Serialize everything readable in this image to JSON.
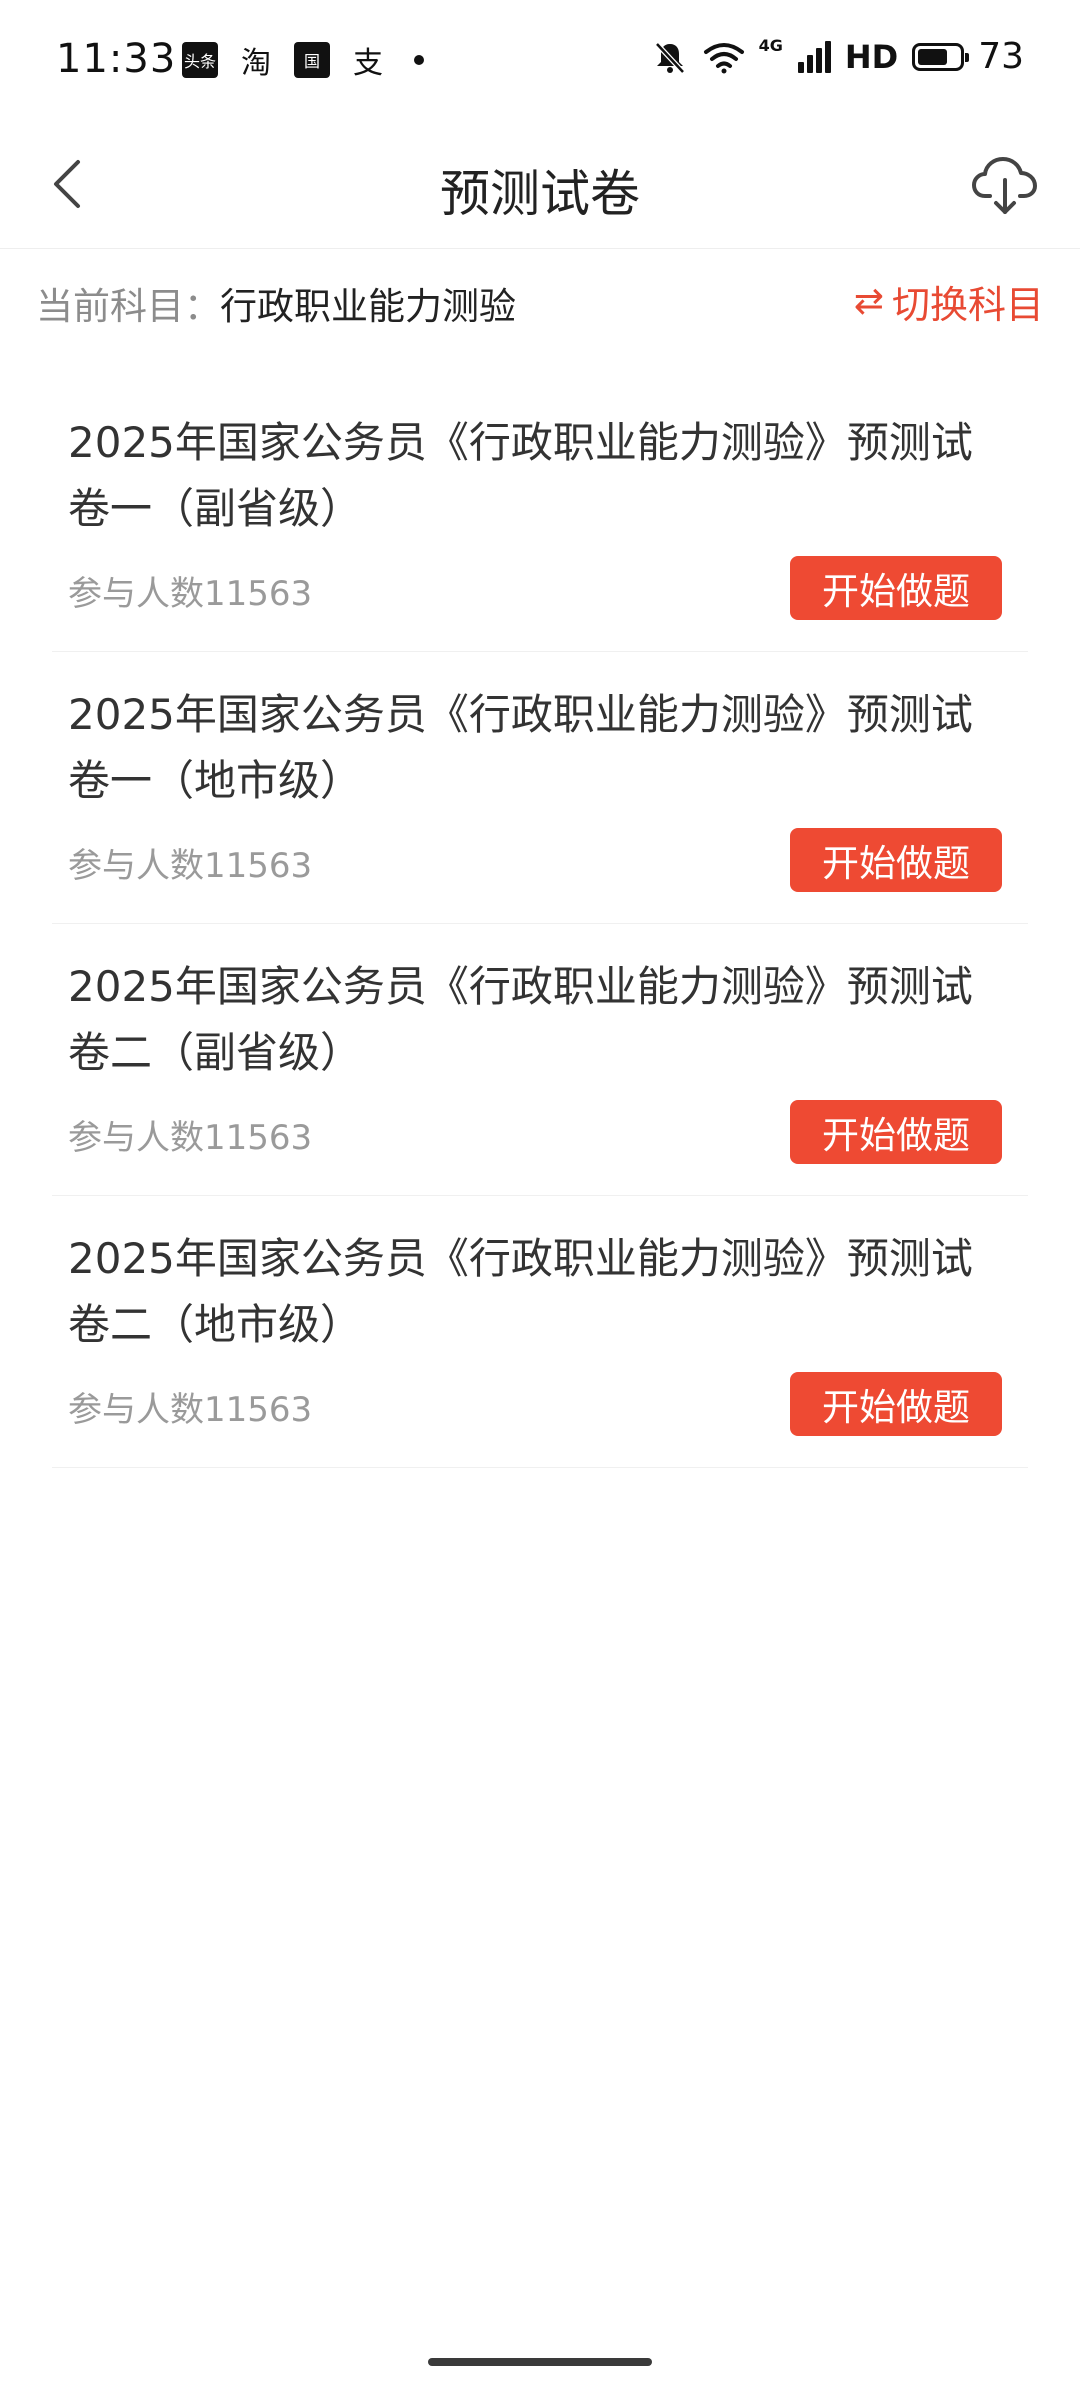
{
  "status_bar": {
    "time": "11:33",
    "apps": [
      "头条",
      "淘",
      "国",
      "支"
    ],
    "network": "4G",
    "hd": "HD",
    "battery_level": "73",
    "battery_fraction": 0.73
  },
  "nav": {
    "title": "预测试卷",
    "back_icon": "chevron-left-icon",
    "download_icon": "cloud-download-icon"
  },
  "subject": {
    "label": "当前科目：",
    "value": "行政职业能力测验",
    "switch_icon": "⇄",
    "switch_label": "切换科目",
    "accent_color": "#e84a33"
  },
  "papers": [
    {
      "title": "2025年国家公务员《行政职业能力测验》预测试卷一（副省级）",
      "participants": "参与人数11563",
      "button": "开始做题"
    },
    {
      "title": "2025年国家公务员《行政职业能力测验》预测试卷一（地市级）",
      "participants": "参与人数11563",
      "button": "开始做题"
    },
    {
      "title": "2025年国家公务员《行政职业能力测验》预测试卷二（副省级）",
      "participants": "参与人数11563",
      "button": "开始做题"
    },
    {
      "title": "2025年国家公务员《行政职业能力测验》预测试卷二（地市级）",
      "participants": "参与人数11563",
      "button": "开始做题"
    }
  ],
  "colors": {
    "primary_button": "#ee4a33",
    "text_primary": "#333333",
    "text_secondary": "#9a9a9a"
  }
}
